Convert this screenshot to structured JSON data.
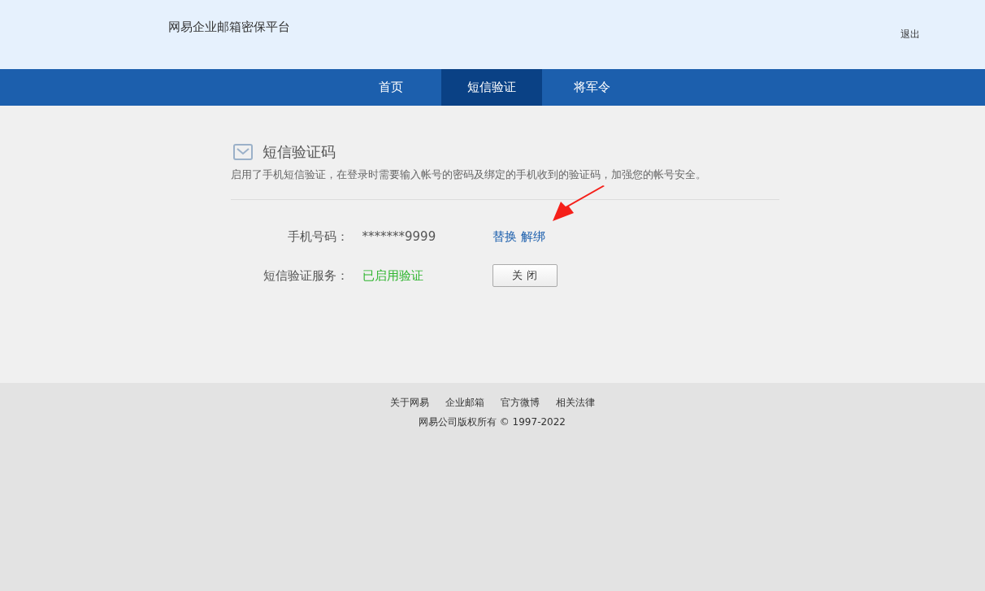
{
  "header": {
    "title": "网易企业邮箱密保平台",
    "logout": "退出"
  },
  "nav": [
    {
      "label": "首页",
      "selected": false
    },
    {
      "label": "短信验证",
      "selected": true
    },
    {
      "label": "将军令",
      "selected": false
    }
  ],
  "section": {
    "title": "短信验证码",
    "description": "启用了手机短信验证，在登录时需要输入帐号的密码及绑定的手机收到的验证码，加强您的帐号安全。"
  },
  "phone": {
    "label": "手机号码：",
    "value": "*******9999",
    "links": [
      "替换",
      "解绑"
    ]
  },
  "service": {
    "label": "短信验证服务：",
    "status": "已启用验证",
    "enabled": true,
    "button": "关 闭"
  },
  "footer": {
    "links": [
      "关于网易",
      "企业邮箱",
      "官方微博",
      "相关法律"
    ],
    "copyright": "网易公司版权所有 © 1997-2022"
  }
}
